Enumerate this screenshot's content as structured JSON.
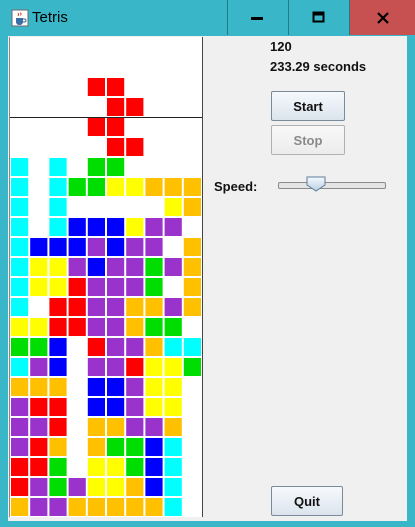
{
  "window": {
    "title": "Tetris",
    "minimize_symbol": "▬",
    "maximize_symbol": "■",
    "close_symbol": "x"
  },
  "status": {
    "score": "120",
    "time": "233.29 seconds"
  },
  "controls": {
    "start_label": "Start",
    "stop_label": "Stop",
    "stop_enabled": false,
    "speed_label": "Speed:",
    "speed_value_fraction": 0.33,
    "quit_label": "Quit"
  },
  "colors": {
    "R": "#ff0000",
    "Y": "#ffff00",
    "O": "#ffc000",
    "G": "#00dd00",
    "C": "#00ffff",
    "B": "#0000ff",
    "P": "#9933cc",
    "titlebar": "#39b7c9",
    "close_button": "#c75050"
  },
  "board": {
    "columns": 10,
    "preview": [
      "....RR....",
      ".....RR..."
    ],
    "falling_piece": [
      "....RR....",
      ".....RR..."
    ],
    "grid": [
      "..........",
      "..........",
      "C.C.GG....",
      "C.CGGYYOOO",
      "C.C.....YO",
      "C.CBBBYPP.",
      "CBBBPBPP.O",
      "CYYPBPPGPO",
      "CYYRPPPG.O",
      "C.RRPPOOPO",
      "YYRRPPOGG.",
      "GGB.RPPOCC",
      "CPB.PPRYYG",
      "OOO.BBPYY.",
      "PRR.BBPYY.",
      "PPR.OOPPO.",
      "PRO.OGGBC.",
      "RRG.YYGBC.",
      "RPGPYYOBC.",
      "OPPOOOOOC."
    ]
  }
}
